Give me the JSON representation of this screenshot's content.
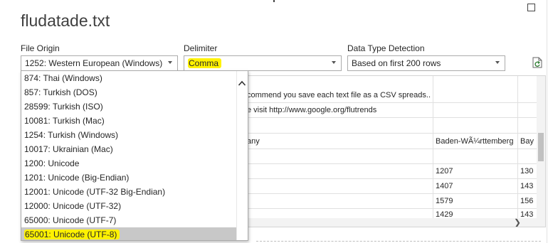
{
  "file_title": "fludatade.txt",
  "file_origin": {
    "label": "File Origin",
    "value": "1252: Western European (Windows)",
    "options": [
      "874: Thai (Windows)",
      "857: Turkish (DOS)",
      "28599: Turkish (ISO)",
      "10081: Turkish (Mac)",
      "1254: Turkish (Windows)",
      "10017: Ukrainian (Mac)",
      "1200: Unicode",
      "1201: Unicode (Big-Endian)",
      "12001: Unicode (UTF-32 Big-Endian)",
      "12000: Unicode (UTF-32)",
      "65000: Unicode (UTF-7)",
      "65001: Unicode (UTF-8)"
    ],
    "selected_option": "65001: Unicode (UTF-8)"
  },
  "delimiter": {
    "label": "Delimiter",
    "value": "Comma"
  },
  "data_type_detection": {
    "label": "Data Type Detection",
    "value": "Based on first 200 rows"
  },
  "preview": {
    "rows": [
      {
        "c1": "commend you save each text file as a CSV spreads...",
        "c2": "",
        "c3": ""
      },
      {
        "c1": "e visit http://www.google.org/flutrends",
        "c2": "",
        "c3": ""
      },
      {
        "c1": "",
        "c2": "",
        "c3": ""
      },
      {
        "c1": "any",
        "c2": "Baden-WÃ¼rttemberg",
        "c3": "Bay"
      },
      {
        "c1": "",
        "c2": "",
        "c3": ""
      },
      {
        "c1": "",
        "c2": "1207",
        "c3": "130"
      },
      {
        "c1": "",
        "c2": "1407",
        "c3": "143"
      },
      {
        "c1": "",
        "c2": "1579",
        "c3": "156"
      },
      {
        "c1": "",
        "c2": "1429",
        "c3": "143"
      }
    ]
  },
  "colors": {
    "highlight": "#fff200",
    "selected_row": "#c8c8c8",
    "border": "#ababab"
  }
}
